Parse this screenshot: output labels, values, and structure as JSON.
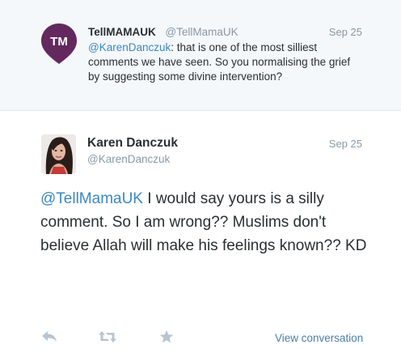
{
  "parent_tweet": {
    "avatar_text": "TM",
    "name": "TellMAMAUK",
    "handle": "@TellMamaUK",
    "date": "Sep 25",
    "mention": "@KarenDanczuk",
    "text": ": that is one of the most silliest comments we have seen. So you normalising the grief by suggesting some divine intervention?",
    "avatar_color": "#63295f"
  },
  "main_tweet": {
    "name": "Karen Danczuk",
    "handle": "@KarenDanczuk",
    "date": "Sep 25",
    "mention": "@TellMamaUK",
    "text": " I would say yours is a silly comment. So I am wrong?? Muslims don't believe Allah will make his feelings known?? KD"
  },
  "actions": {
    "reply_icon": "reply-icon",
    "retweet_icon": "retweet-icon",
    "favorite_icon": "star-icon",
    "view_conversation": "View conversation"
  },
  "colors": {
    "link": "#3b88c3",
    "muted": "#8899a6",
    "icon": "#b8c5cf"
  }
}
